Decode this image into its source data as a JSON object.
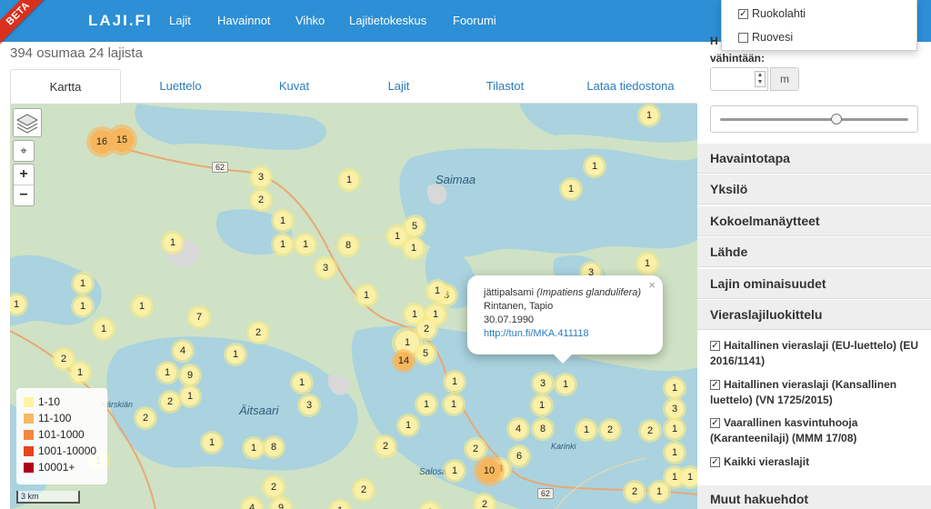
{
  "nav": {
    "beta": "BETA",
    "brand": "LAJI.FI",
    "items": [
      "Lajit",
      "Havainnot",
      "Vihko",
      "Lajitietokeskus",
      "Foorumi"
    ]
  },
  "dropdown": {
    "options": [
      {
        "label": "Ruokolahti",
        "checked": true
      },
      {
        "label": "Ruovesi",
        "checked": false
      }
    ]
  },
  "results": {
    "summary": "394 osumaa 24 lajista"
  },
  "tabs": [
    "Kartta",
    "Luettelo",
    "Kuvat",
    "Lajit",
    "Tilastot",
    "Lataa tiedostona"
  ],
  "map": {
    "place_labels": [
      "Saimaa",
      "Äitsaari",
      "Salosaari",
      "Kärskiän",
      "Karinki"
    ],
    "road_numbers": [
      "62",
      "62"
    ],
    "controls": {
      "locate": "⌖",
      "zoom_in": "+",
      "zoom_out": "−"
    },
    "clusters": [
      {
        "label": "16",
        "size": "orange"
      },
      {
        "label": "15",
        "size": "orange"
      },
      {
        "label": "3"
      },
      {
        "label": "2"
      },
      {
        "label": "1"
      },
      {
        "label": "1"
      },
      {
        "label": "1"
      },
      {
        "label": "1"
      },
      {
        "label": "1"
      },
      {
        "label": "3"
      },
      {
        "label": "8"
      },
      {
        "label": "1"
      },
      {
        "label": "5"
      },
      {
        "label": "1"
      },
      {
        "label": "1"
      },
      {
        "label": "1"
      },
      {
        "label": "1"
      },
      {
        "label": "3"
      },
      {
        "label": "1"
      },
      {
        "label": "1"
      },
      {
        "label": "1"
      },
      {
        "label": "1"
      },
      {
        "label": "1"
      },
      {
        "label": "1"
      },
      {
        "label": "7"
      },
      {
        "label": "1"
      },
      {
        "label": "2"
      },
      {
        "label": "1"
      },
      {
        "label": "1"
      },
      {
        "label": "3"
      },
      {
        "label": "1"
      },
      {
        "label": "2"
      },
      {
        "label": "5"
      },
      {
        "label": "1"
      },
      {
        "label": "14",
        "size": "orange"
      },
      {
        "label": "2"
      },
      {
        "label": "1"
      },
      {
        "label": "4"
      },
      {
        "label": "1"
      },
      {
        "label": "9"
      },
      {
        "label": "1"
      },
      {
        "label": "2"
      },
      {
        "label": "1"
      },
      {
        "label": "2"
      },
      {
        "label": "1"
      },
      {
        "label": "3"
      },
      {
        "label": "1"
      },
      {
        "label": "1"
      },
      {
        "label": "3"
      },
      {
        "label": "1"
      },
      {
        "label": "1"
      },
      {
        "label": "4"
      },
      {
        "label": "8"
      },
      {
        "label": "1"
      },
      {
        "label": "1"
      },
      {
        "label": "2"
      },
      {
        "label": "2"
      },
      {
        "label": "3"
      },
      {
        "label": "1"
      },
      {
        "label": "1"
      },
      {
        "label": "1"
      },
      {
        "label": "1"
      },
      {
        "label": "2"
      },
      {
        "label": "1"
      },
      {
        "label": "1"
      },
      {
        "label": "3"
      },
      {
        "label": "6"
      },
      {
        "label": "10",
        "size": "orange"
      },
      {
        "label": "1"
      },
      {
        "label": "2"
      },
      {
        "label": "1"
      },
      {
        "label": "2"
      },
      {
        "label": "2"
      },
      {
        "label": "8"
      },
      {
        "label": "1"
      },
      {
        "label": "1"
      },
      {
        "label": "1"
      },
      {
        "label": "2"
      },
      {
        "label": "4"
      },
      {
        "label": "9"
      },
      {
        "label": "1"
      },
      {
        "label": "1"
      },
      {
        "label": "2"
      }
    ],
    "legend": [
      {
        "label": "1-10",
        "color": "#fff3a6"
      },
      {
        "label": "11-100",
        "color": "#f9b867"
      },
      {
        "label": "101-1000",
        "color": "#f5883c"
      },
      {
        "label": "1001-10000",
        "color": "#e8431f"
      },
      {
        "label": "10001+",
        "color": "#b00018"
      }
    ],
    "scale": "3 km",
    "popup": {
      "common_name": "jättipalsami",
      "scientific_name": "(Impatiens glandulifera)",
      "observer": "Rintanen, Tapio",
      "date": "30.07.1990",
      "link": "http://tun.fi/MKA.411118",
      "close": "×"
    }
  },
  "right_panel": {
    "clipped_label": "H",
    "min_label": "vähintään:",
    "number_value": "",
    "unit": "m",
    "spinner_up": "▲",
    "spinner_down": "▼",
    "slider_value_fraction": 0.62,
    "sections": [
      "Havaintotapa",
      "Yksilö",
      "Kokoelmanäytteet",
      "Lähde",
      "Lajin ominaisuudet",
      "Vieraslajiluokittelu"
    ],
    "checkboxes": [
      {
        "label": "Haitallinen vieraslaji (EU-luettelo) (EU 2016/1141)",
        "checked": true
      },
      {
        "label": "Haitallinen vieraslaji (Kansallinen luettelo) (VN 1725/2015)",
        "checked": true
      },
      {
        "label": "Vaarallinen kasvintuhooja (Karanteenilaji) (MMM 17/08)",
        "checked": true
      },
      {
        "label": "Kaikki vieraslajit",
        "checked": true
      }
    ],
    "bottom_section": "Muut hakuehdot"
  },
  "colors": {
    "nav_blue": "#2d8fd5",
    "link_blue": "#2a7bbf",
    "map_green": "#cfe2c5",
    "water": "#aad3df",
    "beta_red": "#d9301e"
  }
}
